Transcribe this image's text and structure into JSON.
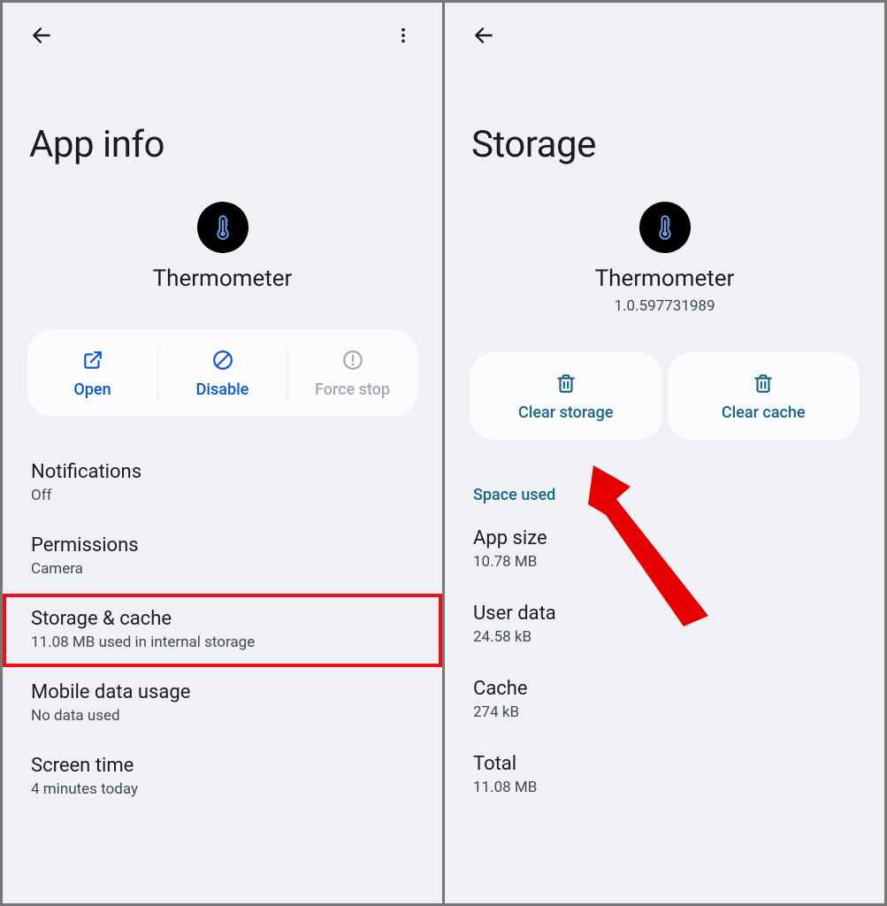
{
  "left": {
    "title": "App info",
    "app_name": "Thermometer",
    "actions": {
      "open": "Open",
      "disable": "Disable",
      "force_stop": "Force stop"
    },
    "items": [
      {
        "title": "Notifications",
        "sub": "Off"
      },
      {
        "title": "Permissions",
        "sub": "Camera"
      },
      {
        "title": "Storage & cache",
        "sub": "11.08 MB used in internal storage"
      },
      {
        "title": "Mobile data usage",
        "sub": "No data used"
      },
      {
        "title": "Screen time",
        "sub": "4 minutes today"
      }
    ]
  },
  "right": {
    "title": "Storage",
    "app_name": "Thermometer",
    "app_version": "1.0.597731989",
    "actions": {
      "clear_storage": "Clear storage",
      "clear_cache": "Clear cache"
    },
    "section_label": "Space used",
    "stats": [
      {
        "title": "App size",
        "sub": "10.78 MB"
      },
      {
        "title": "User data",
        "sub": "24.58 kB"
      },
      {
        "title": "Cache",
        "sub": "274 kB"
      },
      {
        "title": "Total",
        "sub": "11.08 MB"
      }
    ]
  }
}
